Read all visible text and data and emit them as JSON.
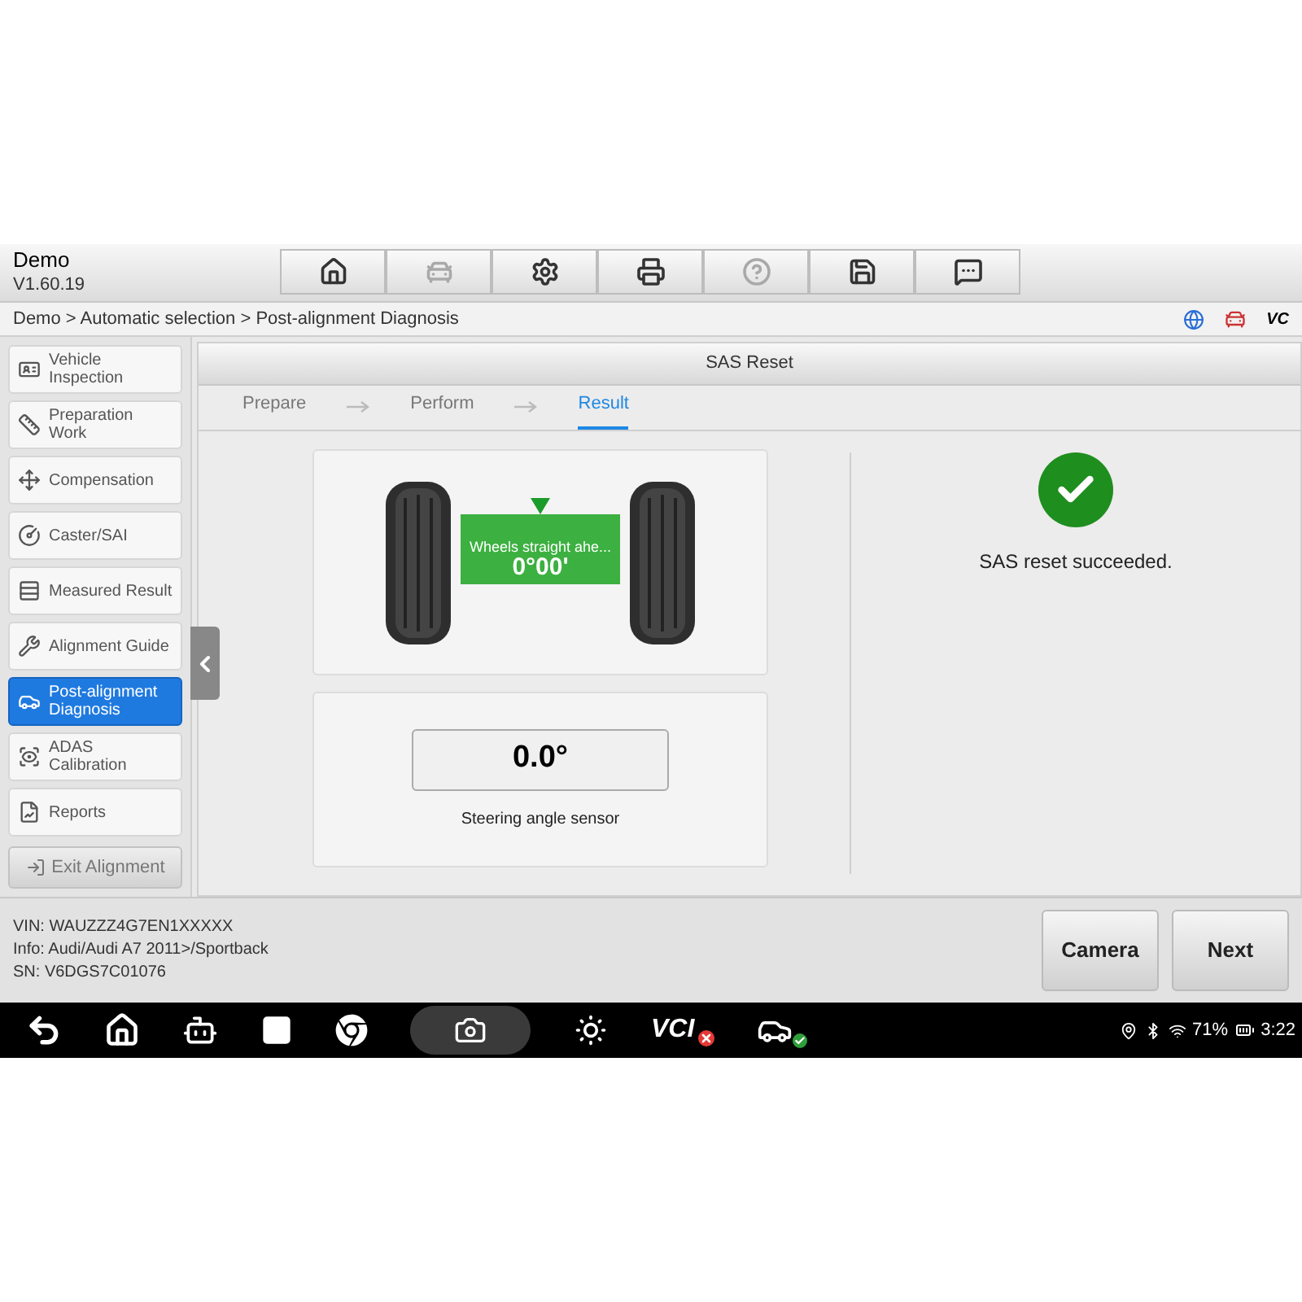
{
  "header": {
    "title": "Demo",
    "version": "V1.60.19"
  },
  "toolbar": [
    {
      "kind": "home",
      "disabled": false
    },
    {
      "kind": "lift",
      "disabled": true
    },
    {
      "kind": "settings",
      "disabled": false
    },
    {
      "kind": "print",
      "disabled": false
    },
    {
      "kind": "help",
      "disabled": true
    },
    {
      "kind": "save",
      "disabled": false
    },
    {
      "kind": "message",
      "disabled": false
    }
  ],
  "breadcrumb": "Demo > Automatic selection > Post-alignment Diagnosis",
  "status_icons": {
    "vci_label": "VC"
  },
  "sidebar": {
    "items": [
      {
        "kind": "inspection",
        "label": "Vehicle Inspection",
        "selected": false
      },
      {
        "kind": "preparation",
        "label": "Preparation Work",
        "selected": false
      },
      {
        "kind": "compensation",
        "label": "Compensation",
        "selected": false
      },
      {
        "kind": "caster",
        "label": "Caster/SAI",
        "selected": false
      },
      {
        "kind": "measured",
        "label": "Measured Result",
        "selected": false
      },
      {
        "kind": "guide",
        "label": "Alignment Guide",
        "selected": false
      },
      {
        "kind": "post",
        "label": "Post-alignment Diagnosis",
        "selected": true
      },
      {
        "kind": "adas",
        "label": "ADAS Calibration",
        "selected": false
      },
      {
        "kind": "reports",
        "label": "Reports",
        "selected": false
      }
    ],
    "exit_button": "Exit Alignment"
  },
  "panel": {
    "title": "SAS Reset",
    "steps": [
      {
        "label": "Prepare",
        "selected": false
      },
      {
        "label": "Perform",
        "selected": false
      },
      {
        "label": "Result",
        "selected": true
      }
    ],
    "gauge": {
      "caption": "Wheels straight ahe...",
      "reading": "0°00'"
    },
    "sensor": {
      "value": "0.0°",
      "label": "Steering angle sensor"
    },
    "result": {
      "success": true,
      "message": "SAS reset succeeded."
    }
  },
  "info": {
    "lines": [
      "VIN: WAUZZZ4G7EN1XXXXX",
      "Info: Audi/Audi A7 2011>/Sportback",
      "SN: V6DGS7C01076"
    ]
  },
  "buttons": [
    "Camera",
    "Next"
  ],
  "navbar": {
    "vci_label": "VCI",
    "battery": "71%",
    "time": "3:22"
  }
}
